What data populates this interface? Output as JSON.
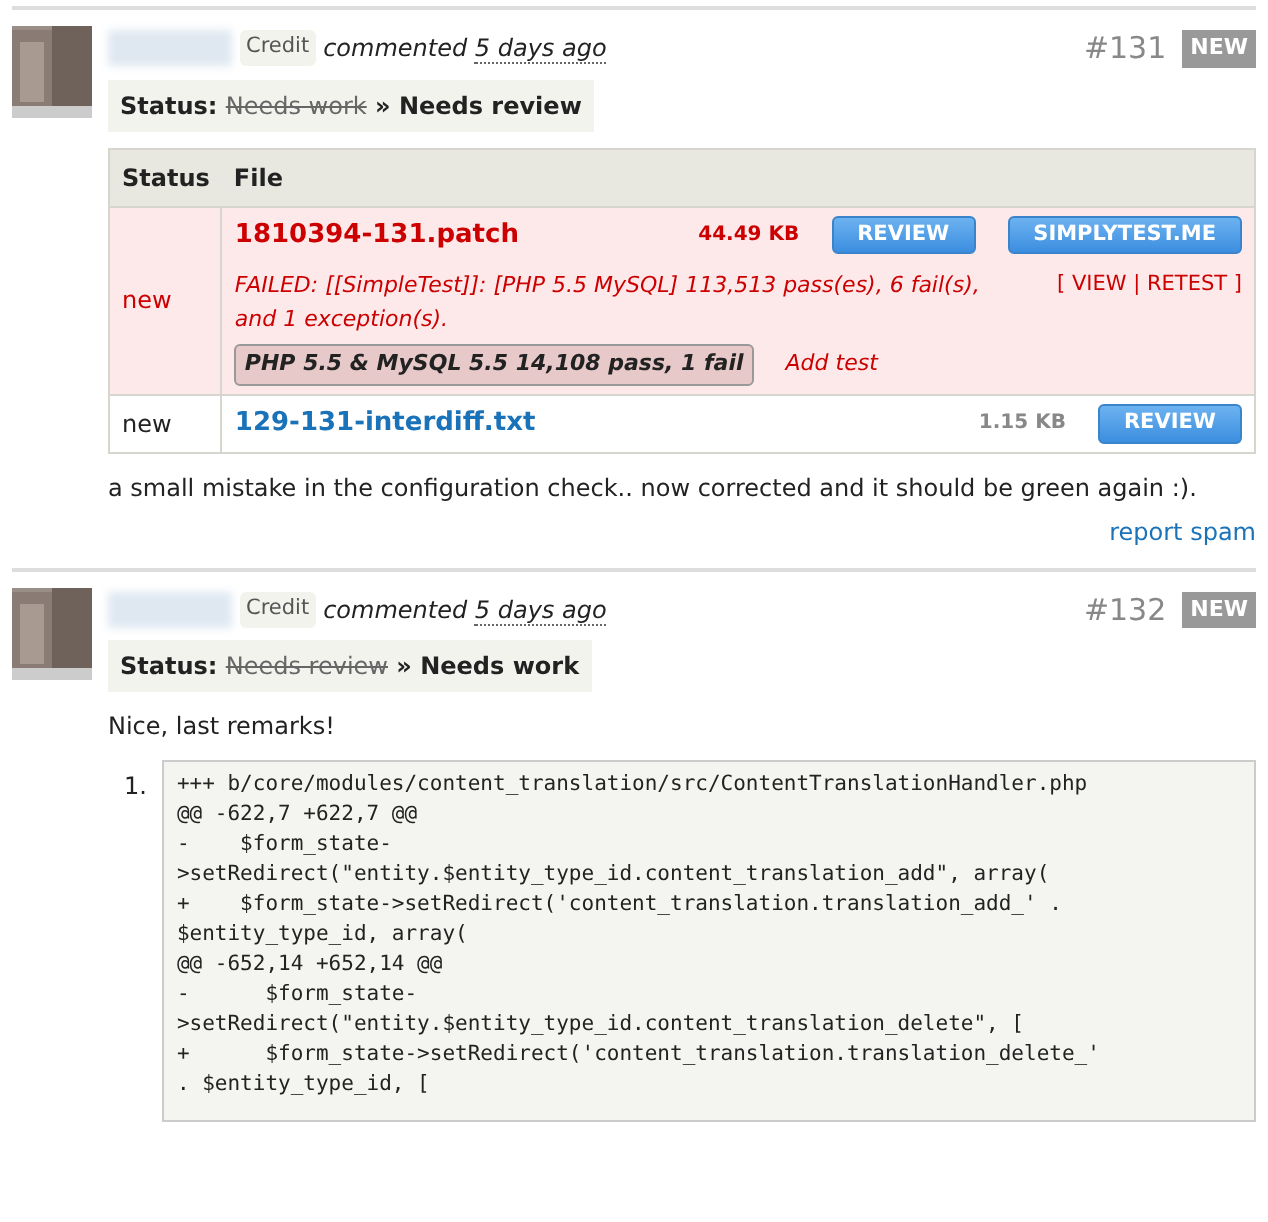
{
  "comments": [
    {
      "credit": "Credit",
      "action": "commented",
      "time": "5 days ago",
      "number": "#131",
      "badge": "NEW",
      "status": {
        "label": "Status:",
        "old": "Needs work",
        "arrow": "»",
        "new": "Needs review"
      },
      "files": {
        "columns": [
          "Status",
          "File"
        ],
        "rows": [
          {
            "kind": "failed",
            "status": "new",
            "name": "1810394-131.patch",
            "size": "44.49 KB",
            "buttons": [
              "REVIEW",
              "SIMPLYTEST.ME"
            ],
            "message": "FAILED: [[SimpleTest]]: [PHP 5.5 MySQL] 113,513 pass(es), 6 fail(s), and 1 exception(s).",
            "actions": {
              "open": "[",
              "items": [
                "VIEW",
                "RETEST"
              ],
              "separator": "|",
              "close": "]"
            },
            "test": "PHP 5.5 & MySQL 5.5 14,108 pass, 1 fail",
            "add_test": "Add test"
          },
          {
            "kind": "plain",
            "status": "new",
            "name": "129-131-interdiff.txt",
            "size": "1.15 KB",
            "buttons": [
              "REVIEW"
            ]
          }
        ]
      },
      "body": "a small mistake in the configuration check.. now corrected and it should be green again :).",
      "link": "report spam"
    },
    {
      "credit": "Credit",
      "action": "commented",
      "time": "5 days ago",
      "number": "#132",
      "badge": "NEW",
      "status": {
        "label": "Status:",
        "old": "Needs review",
        "arrow": "»",
        "new": "Needs work"
      },
      "body": "Nice, last remarks!",
      "code": {
        "marker": "1.",
        "lines": [
          "+++ b/core/modules/content_translation/src/ContentTranslationHandler.php",
          "@@ -622,7 +622,7 @@",
          "-    $form_state-",
          ">setRedirect(\"entity.$entity_type_id.content_translation_add\", array(",
          "+    $form_state->setRedirect('content_translation.translation_add_' .",
          "$entity_type_id, array(",
          "@@ -652,14 +652,14 @@",
          "-      $form_state-",
          ">setRedirect(\"entity.$entity_type_id.content_translation_delete\", [",
          "+      $form_state->setRedirect('content_translation.translation_delete_'",
          ". $entity_type_id, ["
        ]
      }
    }
  ]
}
